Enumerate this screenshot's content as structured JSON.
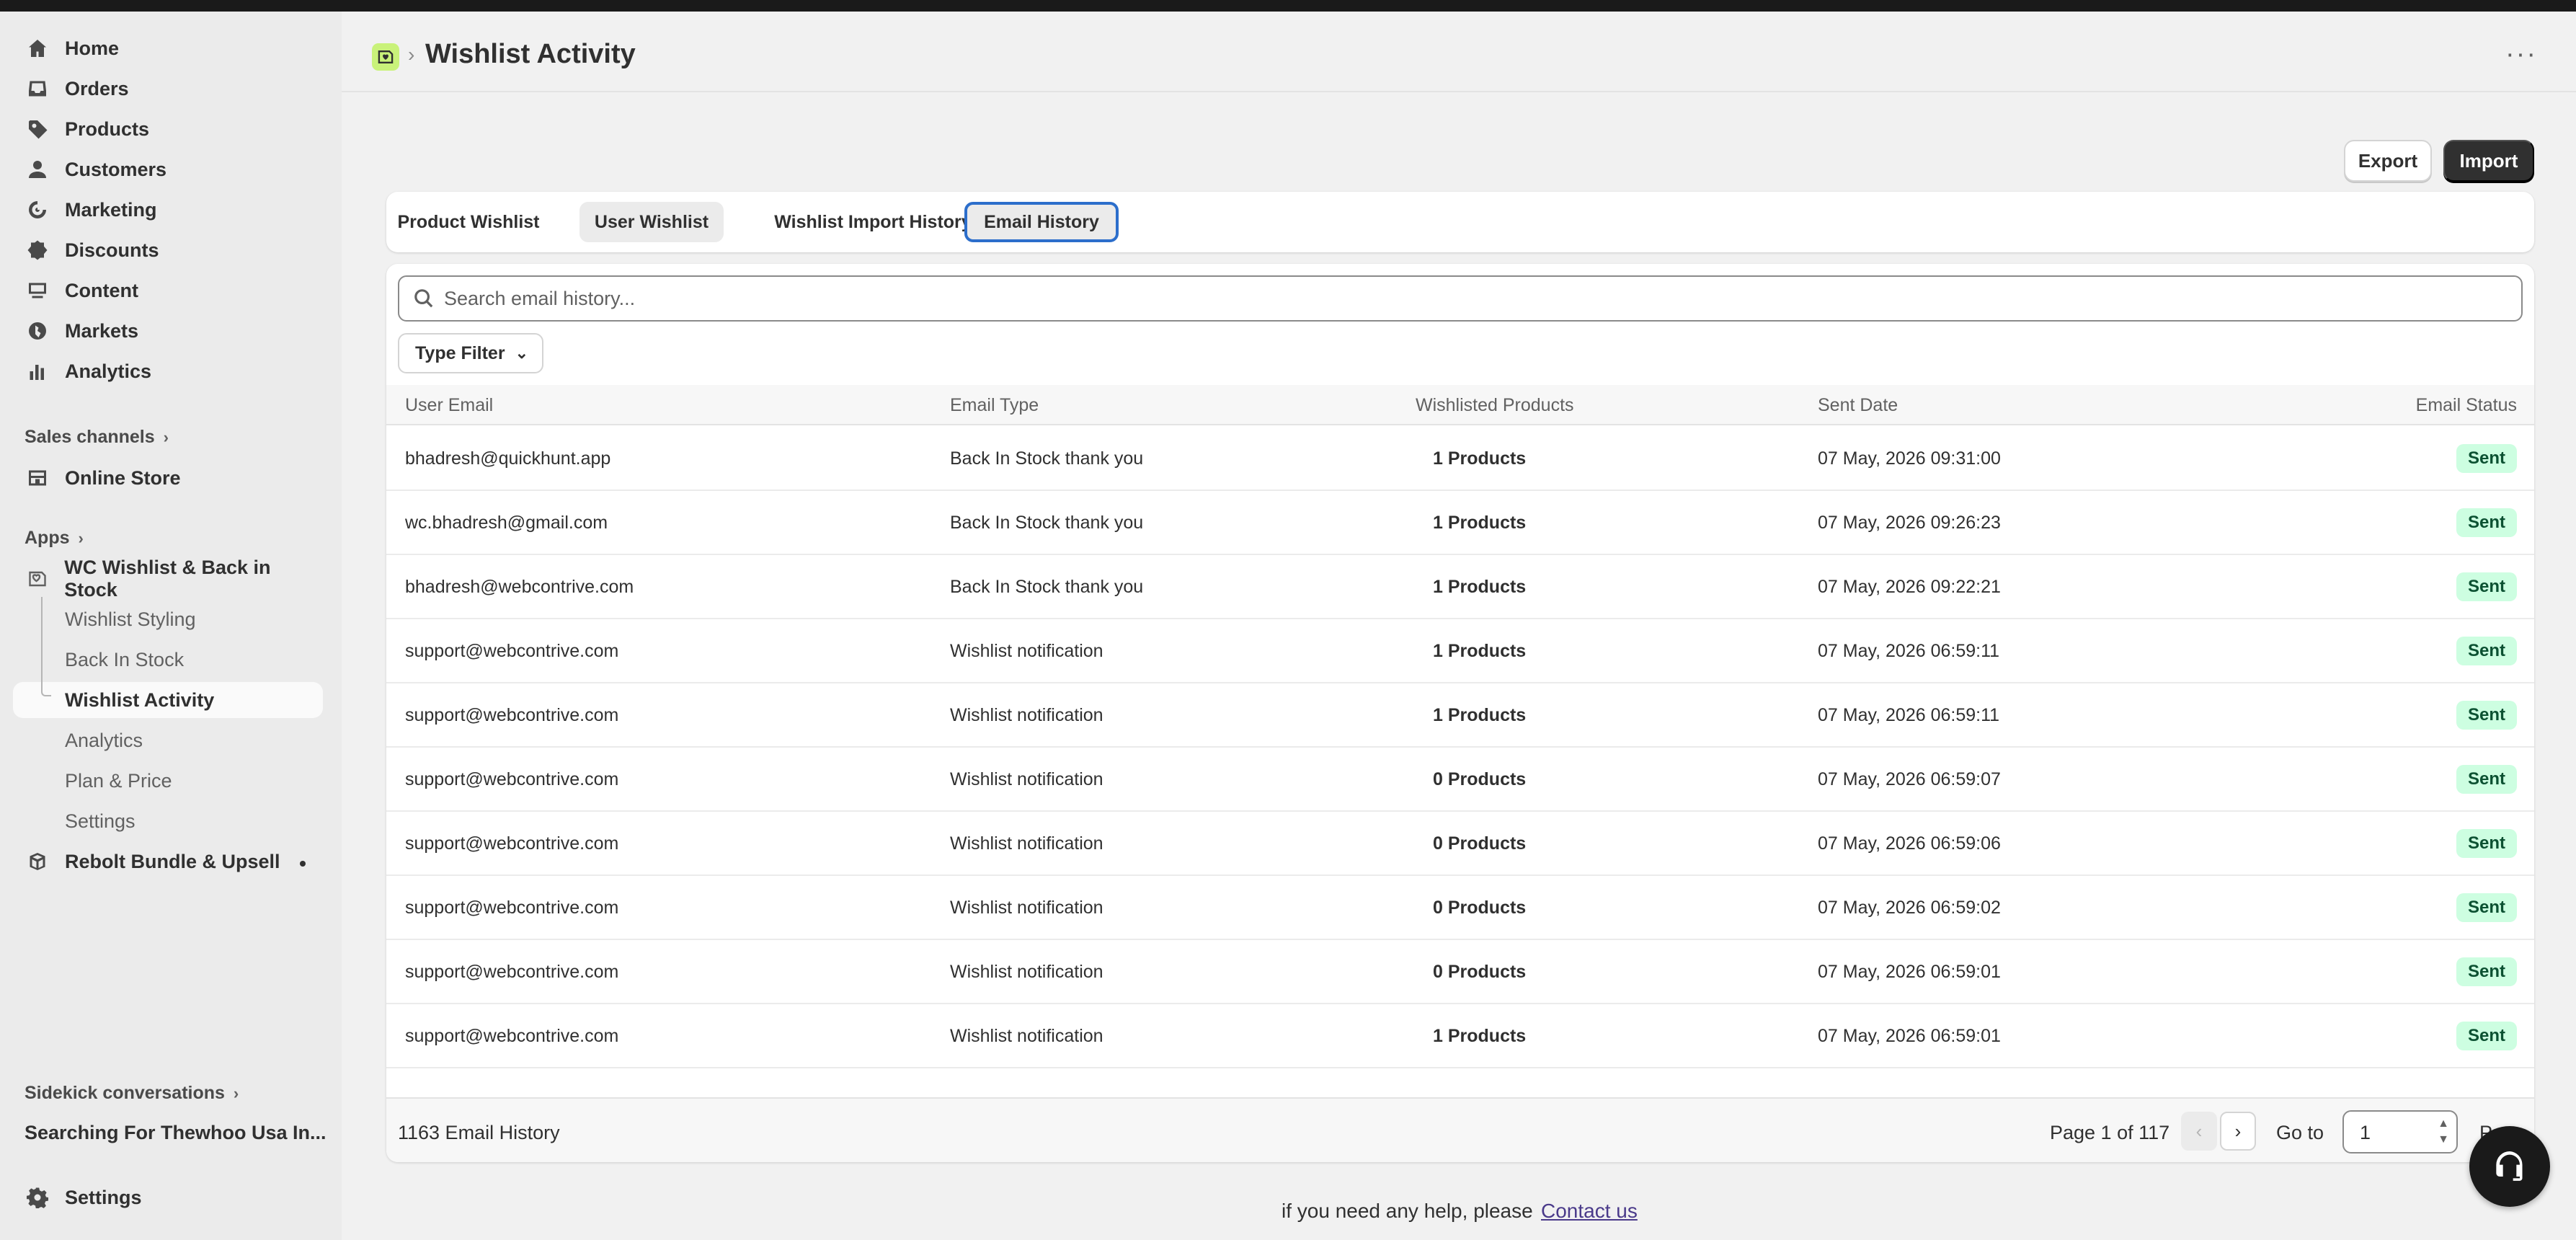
{
  "sidebar": {
    "nav": [
      {
        "label": "Home",
        "icon": "home-icon"
      },
      {
        "label": "Orders",
        "icon": "inbox-icon"
      },
      {
        "label": "Products",
        "icon": "tag-icon"
      },
      {
        "label": "Customers",
        "icon": "person-icon"
      },
      {
        "label": "Marketing",
        "icon": "target-icon"
      },
      {
        "label": "Discounts",
        "icon": "discount-icon"
      },
      {
        "label": "Content",
        "icon": "content-icon"
      },
      {
        "label": "Markets",
        "icon": "globe-icon"
      },
      {
        "label": "Analytics",
        "icon": "bar-chart-icon"
      }
    ],
    "sales_channels_label": "Sales channels",
    "online_store_label": "Online Store",
    "apps_label": "Apps",
    "app_name": "WC Wishlist & Back in Stock",
    "app_subitems": [
      "Wishlist Styling",
      "Back In Stock",
      "Wishlist Activity",
      "Analytics",
      "Plan & Price",
      "Settings"
    ],
    "other_app": "Rebolt Bundle & Upsell",
    "sidekick_label": "Sidekick conversations",
    "sidekick_item": "Searching For Thewhoo Usa In...",
    "settings_label": "Settings"
  },
  "header": {
    "title": "Wishlist Activity",
    "more": "···"
  },
  "actions": {
    "export": "Export",
    "import": "Import"
  },
  "tabs": [
    "Product Wishlist",
    "User Wishlist",
    "Wishlist Import History",
    "Email History"
  ],
  "search": {
    "placeholder": "Search email history..."
  },
  "filter": {
    "label": "Type Filter"
  },
  "table": {
    "headers": [
      "User Email",
      "Email Type",
      "Wishlisted Products",
      "Sent Date",
      "Email Status"
    ],
    "rows": [
      {
        "email": "bhadresh@quickhunt.app",
        "type": "Back In Stock thank you",
        "products": "1 Products",
        "date": "07 May, 2026 09:31:00",
        "status": "Sent"
      },
      {
        "email": "wc.bhadresh@gmail.com",
        "type": "Back In Stock thank you",
        "products": "1 Products",
        "date": "07 May, 2026 09:26:23",
        "status": "Sent"
      },
      {
        "email": "bhadresh@webcontrive.com",
        "type": "Back In Stock thank you",
        "products": "1 Products",
        "date": "07 May, 2026 09:22:21",
        "status": "Sent"
      },
      {
        "email": "support@webcontrive.com",
        "type": "Wishlist notification",
        "products": "1 Products",
        "date": "07 May, 2026 06:59:11",
        "status": "Sent"
      },
      {
        "email": "support@webcontrive.com",
        "type": "Wishlist notification",
        "products": "1 Products",
        "date": "07 May, 2026 06:59:11",
        "status": "Sent"
      },
      {
        "email": "support@webcontrive.com",
        "type": "Wishlist notification",
        "products": "0 Products",
        "date": "07 May, 2026 06:59:07",
        "status": "Sent"
      },
      {
        "email": "support@webcontrive.com",
        "type": "Wishlist notification",
        "products": "0 Products",
        "date": "07 May, 2026 06:59:06",
        "status": "Sent"
      },
      {
        "email": "support@webcontrive.com",
        "type": "Wishlist notification",
        "products": "0 Products",
        "date": "07 May, 2026 06:59:02",
        "status": "Sent"
      },
      {
        "email": "support@webcontrive.com",
        "type": "Wishlist notification",
        "products": "0 Products",
        "date": "07 May, 2026 06:59:01",
        "status": "Sent"
      },
      {
        "email": "support@webcontrive.com",
        "type": "Wishlist notification",
        "products": "1 Products",
        "date": "07 May, 2026 06:59:01",
        "status": "Sent"
      }
    ]
  },
  "footer": {
    "total": "1163 Email History",
    "page_info": "Page 1 of 117",
    "goto_label": "Go to",
    "goto_value": "1",
    "page_label": "Page"
  },
  "help": {
    "text": "if you need any help, please",
    "link": "Contact us"
  },
  "colors": {
    "accent": "#2c6ecb",
    "primary_button": "#303030",
    "status_badge": "#cdfee1",
    "app_icon": "#c9f27a"
  }
}
